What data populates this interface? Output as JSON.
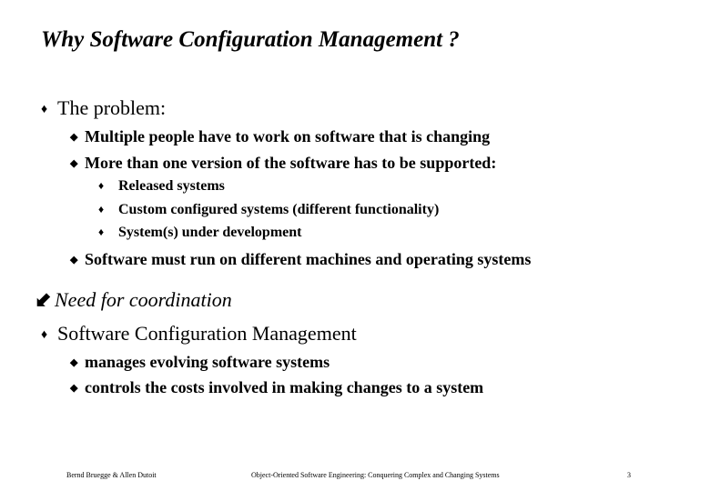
{
  "slide": {
    "title": "Why Software Configuration Management ?",
    "items": [
      {
        "text": "The problem:"
      },
      {
        "text": "Multiple people have to work on software that is changing"
      },
      {
        "text": "More than one version of the software has to be supported:"
      },
      {
        "text": "Released systems"
      },
      {
        "text": "Custom configured systems (different functionality)"
      },
      {
        "text": "System(s) under development"
      },
      {
        "text": "Software must run on different machines and operating systems"
      },
      {
        "text": "Need for coordination"
      },
      {
        "text": "Software Configuration Management"
      },
      {
        "text": "manages evolving software systems"
      },
      {
        "text": "controls the costs involved in making changes to a system"
      }
    ],
    "bullets": {
      "level1": "♦",
      "level2": "◆",
      "level3": "♦",
      "arrow": "⬋"
    }
  },
  "footer": {
    "authors": "Bernd Bruegge & Allen Dutoit",
    "book": "Object-Oriented Software Engineering: Conquering Complex and Changing Systems",
    "page": "3"
  }
}
